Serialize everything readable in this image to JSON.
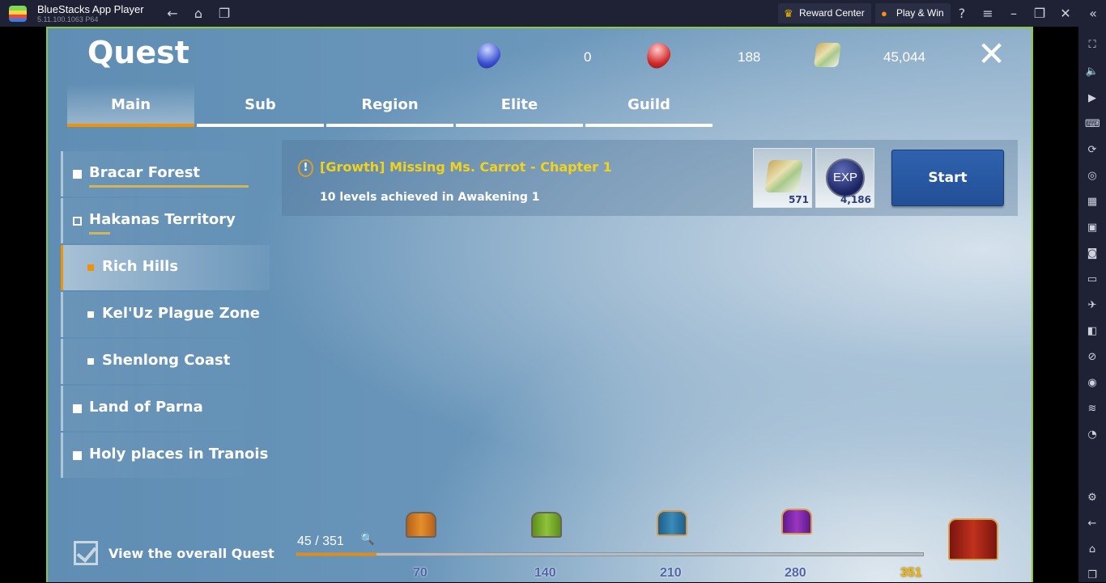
{
  "window": {
    "title": "BlueStacks App Player",
    "version": "5.11.100.1063  P64",
    "reward_center": "Reward Center",
    "play_win": "Play & Win"
  },
  "game": {
    "title": "Quest",
    "currencies": [
      {
        "icon": "blue-gem-icon",
        "value": "0"
      },
      {
        "icon": "red-gem-icon",
        "value": "188"
      },
      {
        "icon": "scroll-icon",
        "value": "45,044"
      }
    ],
    "tabs": [
      {
        "label": "Main",
        "active": true
      },
      {
        "label": "Sub"
      },
      {
        "label": "Region"
      },
      {
        "label": "Elite"
      },
      {
        "label": "Guild"
      }
    ],
    "regions": [
      {
        "label": "Bracar Forest"
      },
      {
        "label": "Hakanas Territory"
      },
      {
        "label": "Rich Hills",
        "selected": true
      },
      {
        "label": "Kel'Uz Plague Zone"
      },
      {
        "label": "Shenlong Coast"
      },
      {
        "label": "Land of Parna"
      },
      {
        "label": "Holy places in Tranois"
      }
    ],
    "quest": {
      "name": "[Growth] Missing Ms. Carrot - Chapter 1",
      "description": "10 levels achieved in Awakening 1",
      "rewards": [
        {
          "icon": "scroll-icon",
          "count": "571"
        },
        {
          "icon": "exp-icon",
          "label": "EXP",
          "count": "4,186"
        }
      ],
      "start_label": "Start"
    },
    "overall_label": "View the overall Quest",
    "overall_checked": true,
    "progress": {
      "text": "45 / 351",
      "current": 45,
      "total": 351,
      "milestones": [
        "70",
        "140",
        "210",
        "280",
        "351"
      ]
    },
    "colors": {
      "accent": "#f39200",
      "quest_title": "#f2d21b",
      "start_button": "#2a59a3",
      "border": "#8dc63f"
    }
  }
}
